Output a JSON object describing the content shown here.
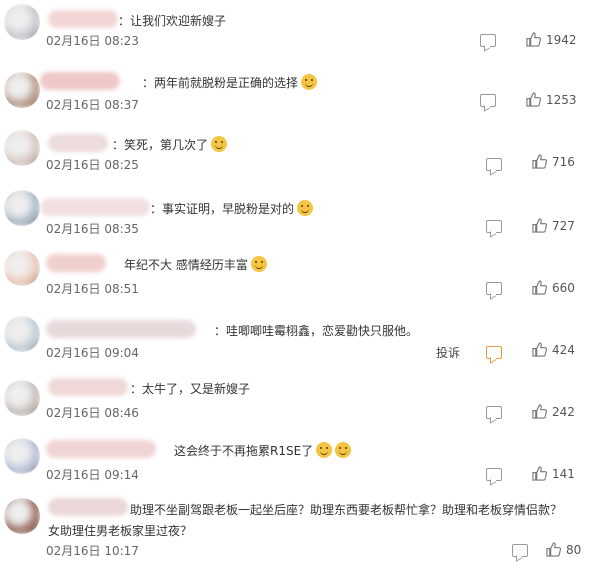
{
  "comments": [
    {
      "text": "：让我们欢迎新嫂子",
      "time": "02月16日 08:23",
      "likes": "1942",
      "emoji": ""
    },
    {
      "text": "：两年前就脱粉是正确的选择",
      "time": "02月16日 08:37",
      "likes": "1253",
      "emoji": "grin-icon"
    },
    {
      "text": "：笑死，第几次了",
      "time": "02月16日 08:25",
      "likes": "716",
      "emoji": "laugh-cry-icon"
    },
    {
      "text": "：事实证明，早脱粉是对的",
      "time": "02月16日 08:35",
      "likes": "727",
      "emoji": "doge-icon"
    },
    {
      "text": "年纪不大 感情经历丰富",
      "time": "02月16日 08:51",
      "likes": "660",
      "emoji": "thumbs-up-icon"
    },
    {
      "text": "：哇唧唧哇霉栩鑫，恋爱勸快只服他。",
      "time": "02月16日 09:04",
      "likes": "424",
      "emoji": "",
      "report": "投诉"
    },
    {
      "text": "：太牛了，又是新嫂子",
      "time": "02月16日 08:46",
      "likes": "242",
      "emoji": ""
    },
    {
      "text": "这会终于不再拖累R1SE了",
      "time": "02月16日 09:14",
      "likes": "141",
      "emoji": "double-emoji"
    },
    {
      "text": "助理不坐副驾跟老板一起坐后座？助理东西要老板帮忙拿？助理和老板穿情侣款？女助理住男老板家里过夜？",
      "time": "02月16日 10:17",
      "likes": "80",
      "emoji": ""
    }
  ],
  "colors": {
    "reply_active": "#e89a42",
    "avatar_palette": [
      "#c8c8d0",
      "#b89a86",
      "#d8c8c0",
      "#a8b8c8",
      "#f0c8b8",
      "#c0d0d8",
      "#c8c0bc",
      "#b8c0d8",
      "#9a6a60"
    ]
  }
}
